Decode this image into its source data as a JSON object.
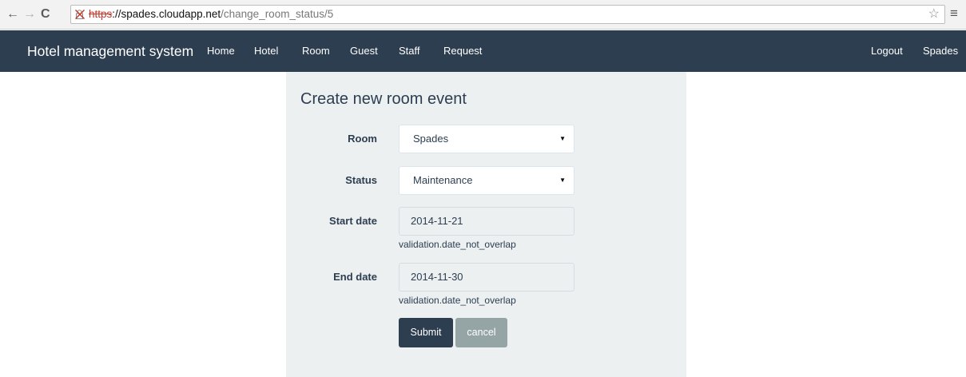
{
  "browser": {
    "url_scheme": "https",
    "url_host": "://spades.cloudapp.net",
    "url_path": "/change_room_status/5",
    "back_icon": "←",
    "forward_icon": "→",
    "reload_icon": "C",
    "star_icon": "☆",
    "menu_icon": "≡"
  },
  "navbar": {
    "brand": "Hotel management system",
    "links": [
      "Home",
      "Hotel",
      "Room",
      "Guest",
      "Staff",
      "Request"
    ],
    "right_links": [
      "Logout",
      "Spades"
    ]
  },
  "form": {
    "title": "Create new room event",
    "room_label": "Room",
    "room_value": "Spades",
    "status_label": "Status",
    "status_value": "Maintenance",
    "start_label": "Start date",
    "start_value": "2014-11-21",
    "start_help": "validation.date_not_overlap",
    "end_label": "End date",
    "end_value": "2014-11-30",
    "end_help": "validation.date_not_overlap",
    "submit_label": "Submit",
    "cancel_label": "cancel"
  },
  "colors": {
    "navbar": "#2c3e50",
    "panel": "#ecf0f1",
    "submit": "#2c3e50",
    "cancel": "#95a5a6"
  }
}
